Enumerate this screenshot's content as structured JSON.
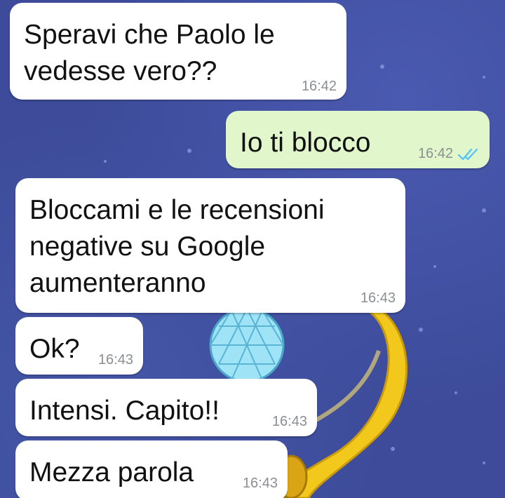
{
  "messages": [
    {
      "direction": "in",
      "text": "Speravi che Paolo le\nvedesse vero??",
      "time": "16:42"
    },
    {
      "direction": "out",
      "text": "Io ti blocco",
      "time": "16:42",
      "status": "read",
      "status_icon": "double-check-icon"
    },
    {
      "direction": "in",
      "text": "Bloccami e le recensioni\nnegative su Google\naumenteranno",
      "time": "16:43"
    },
    {
      "direction": "in",
      "text": "Ok?",
      "time": "16:43"
    },
    {
      "direction": "in",
      "text": "Intensi. Capito!!",
      "time": "16:43"
    },
    {
      "direction": "in",
      "text": "Mezza parola",
      "time": "16:43"
    }
  ],
  "colors": {
    "incoming_bubble": "#ffffff",
    "outgoing_bubble": "#e1f7cb",
    "read_ticks": "#4fc3f7",
    "wallpaper": "#3d4b9a"
  }
}
